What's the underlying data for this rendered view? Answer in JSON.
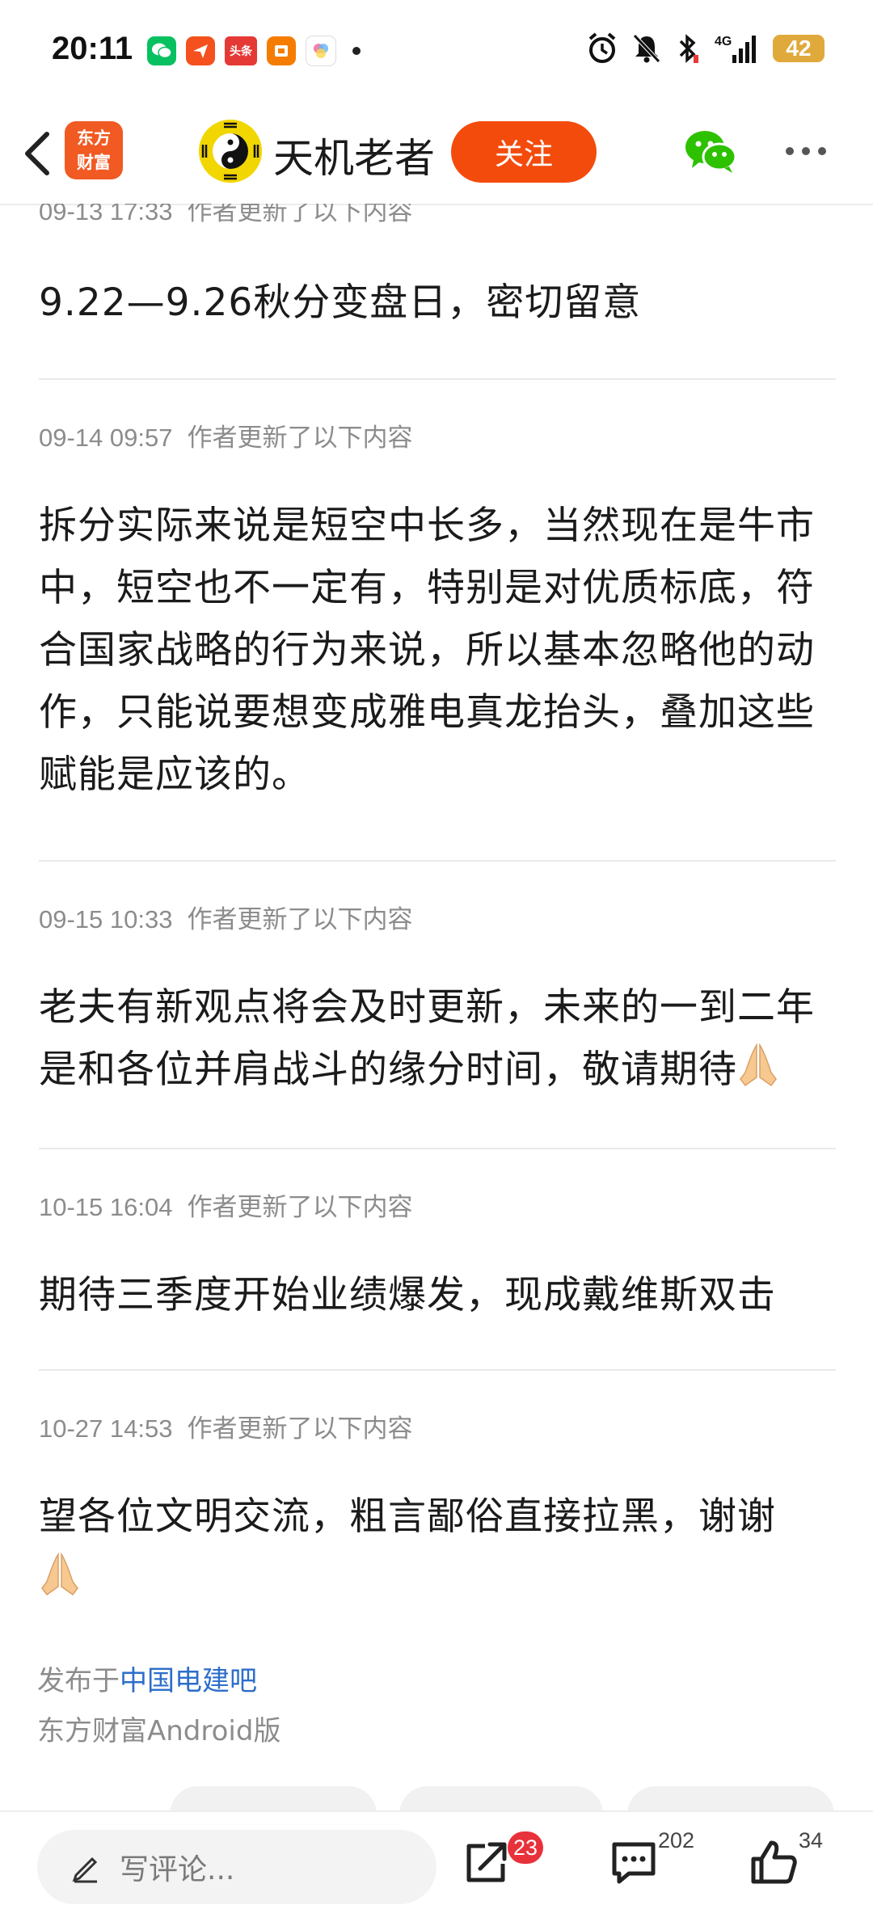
{
  "status_bar": {
    "time": "20:11",
    "notification_apps": [
      "wechat-icon",
      "send-app-icon",
      "toutiao-icon",
      "wallet-app-icon",
      "photos-app-icon"
    ],
    "toutiao_label": "头条",
    "battery": "42",
    "network": "4G"
  },
  "header": {
    "brand_line1": "东方",
    "brand_line2": "财富",
    "author_name": "天机老者",
    "follow_label": "关注"
  },
  "posts": [
    {
      "timestamp": "09-13 17:33",
      "note": "作者更新了以下内容",
      "text": "9.22—9.26秋分变盘日，密切留意"
    },
    {
      "timestamp": "09-14 09:57",
      "note": "作者更新了以下内容",
      "lines": [
        "拆分实际来说是短空中长多，当然现在是牛市",
        "中，短空也不一定有，特别是对优质标底，符",
        "合国家战略的行为来说，所以基本忽略他的动",
        "作，只能说要想变成雅电真龙抬头，叠加这些",
        "赋能是应该的。"
      ]
    },
    {
      "timestamp": "09-15 10:33",
      "note": "作者更新了以下内容",
      "lines": [
        "老夫有新观点将会及时更新，未来的一到二年",
        "是和各位并肩战斗的缘分时间，敬请期待"
      ]
    },
    {
      "timestamp": "10-15 16:04",
      "note": "作者更新了以下内容",
      "text": "期待三季度开始业绩爆发，现成戴维斯双击"
    },
    {
      "timestamp": "10-27 14:53",
      "note": "作者更新了以下内容",
      "text": "望各位文明交流，粗言鄙俗直接拉黑，谢谢"
    }
  ],
  "footer": {
    "published_prefix": "发布于",
    "forum_name": "中国电建吧",
    "client": "东方财富Android版"
  },
  "bottom_bar": {
    "comment_placeholder": "写评论...",
    "share_badge": "23",
    "comment_count": "202",
    "like_count": "34"
  },
  "colors": {
    "accent": "#f34b0c",
    "link": "#2d6ec9",
    "badge": "#e8313a",
    "meta_text": "#8c8c8c"
  }
}
